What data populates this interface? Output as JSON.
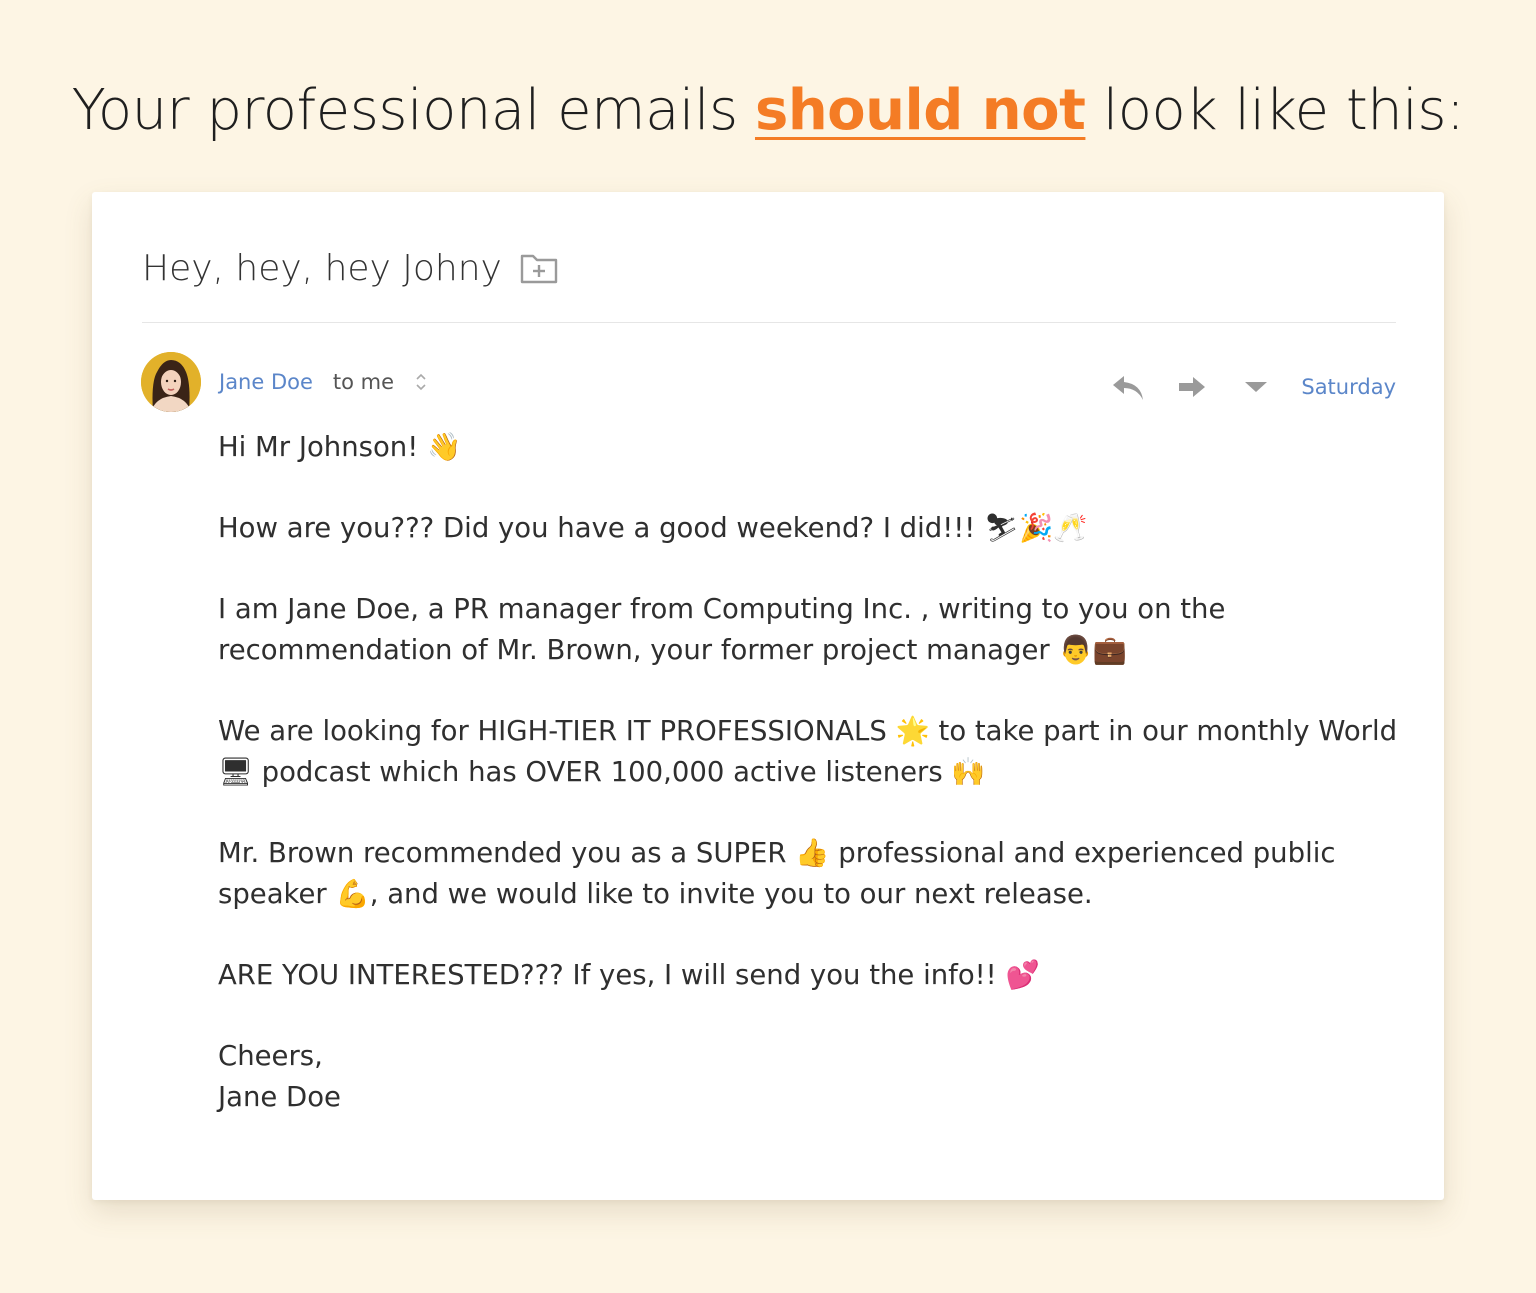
{
  "headline": {
    "before": "Your professional emails ",
    "emphasis": "should not",
    "after": " look like this:"
  },
  "colors": {
    "background": "#fdf5e4",
    "accent_orange": "#f47c25",
    "link_blue": "#5b86c9"
  },
  "email": {
    "subject": "Hey, hey, hey Johny",
    "subject_icon": "folder-plus-icon",
    "sender": "Jane Doe",
    "recipient": "to me",
    "date": "Saturday",
    "actions": [
      "reply-icon",
      "forward-icon",
      "more-icon"
    ],
    "body": [
      "Hi Mr Johnson! 👋",
      "How are you??? Did you have a good weekend? I did!!! ⛷🎉🥂",
      "I am Jane Doe, a PR manager from Computing Inc. , writing to you on the\nrecommendation of Mr. Brown, your former project manager 👨💼",
      "We are looking for HIGH-TIER IT PROFESSIONALS 🌟 to take part in our monthly World\n🖥 podcast which has OVER 100,000 active listeners 🙌",
      "Mr. Brown recommended you as a SUPER 👍 professional and experienced public\nspeaker 💪, and we would like to invite you to our next release.",
      "ARE YOU INTERESTED??? If yes, I will send you the info!! 💕"
    ],
    "signature": "Cheers,\nJane Doe"
  }
}
